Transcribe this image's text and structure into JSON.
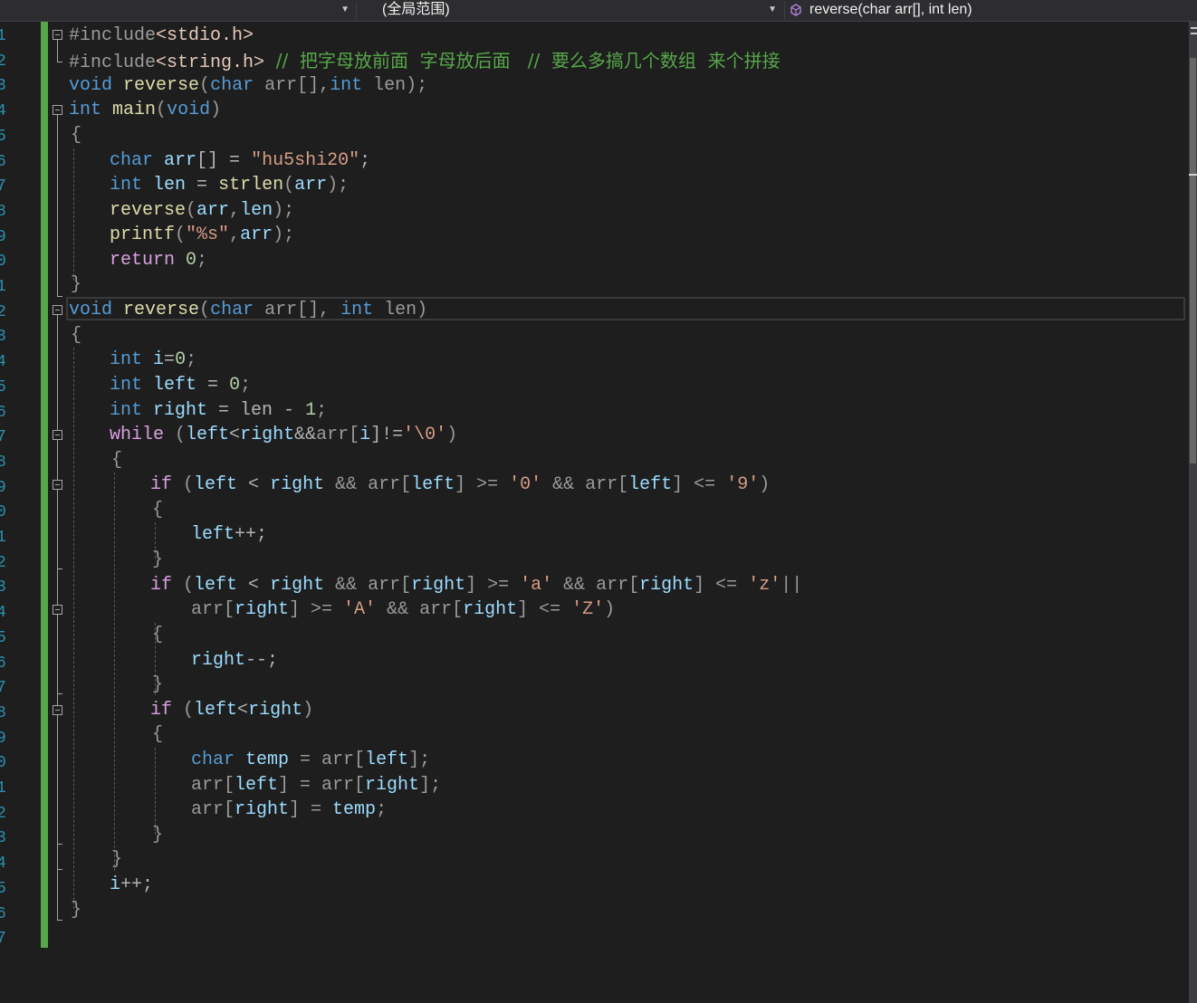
{
  "navbar": {
    "project": "",
    "scope": "(全局范围)",
    "member": "reverse(char arr[], int len)",
    "member_icon": "method-icon",
    "arrow_icon": "chevron-down-icon"
  },
  "line_numbers": [
    "1",
    "2",
    "3",
    "4",
    "5",
    "6",
    "7",
    "8",
    "9",
    "0",
    "1",
    "2",
    "3",
    "4",
    "5",
    "6",
    "7",
    "8",
    "9",
    "0",
    "1",
    "2",
    "3",
    "4",
    "5",
    "6",
    "7",
    "8",
    "9",
    "0",
    "1",
    "2",
    "3",
    "4",
    "5",
    "6",
    "7"
  ],
  "code": {
    "l1": {
      "pp": "#include",
      "inc": "<stdio.h>"
    },
    "l2": {
      "pp": "#include",
      "inc": "<string.h>",
      "comment": "  //  把字母放前面  字母放后面   //  要么多搞几个数组  来个拼接"
    },
    "l3": {
      "t1": "void",
      "t2": " ",
      "t3": "reverse",
      "t4": "(",
      "t5": "char",
      "t6": " arr[],",
      "t7": "int",
      "t8": " len);"
    },
    "l4": {
      "t1": "int",
      "t2": " ",
      "t3": "main",
      "t4": "(",
      "t5": "void",
      "t6": ")"
    },
    "l5": {
      "t1": "{"
    },
    "l6": {
      "t1": "char",
      "t2": " ",
      "t3": "arr",
      "t4": "[] = ",
      "t5": "\"hu5shi20\"",
      "t6": ";"
    },
    "l7": {
      "t1": "int",
      "t2": " ",
      "t3": "len",
      "t4": " = ",
      "t5": "strlen",
      "t6": "(",
      "t7": "arr",
      "t8": ");"
    },
    "l8": {
      "t1": "reverse",
      "t2": "(",
      "t3": "arr",
      "t4": ",",
      "t5": "len",
      "t6": ");"
    },
    "l9": {
      "t1": "printf",
      "t2": "(",
      "t3": "\"%s\"",
      "t4": ",",
      "t5": "arr",
      "t6": ");"
    },
    "l10": {
      "t1": "return",
      "t2": " ",
      "t3": "0",
      "t4": ";"
    },
    "l11": {
      "t1": "}"
    },
    "l12": {
      "t1": "void",
      "t2": " ",
      "t3": "reverse",
      "t4": "(",
      "t5": "char",
      "t6": " arr[], ",
      "t7": "int",
      "t8": " len)"
    },
    "l13": {
      "t1": "{"
    },
    "l14": {
      "t1": "int",
      "t2": " ",
      "t3": "i",
      "t4": "=",
      "t5": "0",
      "t6": ";"
    },
    "l15": {
      "t1": "int",
      "t2": " ",
      "t3": "left",
      "t4": " = ",
      "t5": "0",
      "t6": ";"
    },
    "l16": {
      "t1": "int",
      "t2": " ",
      "t3": "right",
      "t4": " = len - ",
      "t5": "1",
      "t6": ";"
    },
    "l17": {
      "t1": "while",
      "t2": " (",
      "t3": "left",
      "t4": "<",
      "t5": "right",
      "t6": "&&",
      "t7": "arr",
      "t8": "[",
      "t9": "i",
      "t10": "]!=",
      "t11": "'\\0'",
      "t12": ")"
    },
    "l18": {
      "t1": "{"
    },
    "l19": {
      "t1": "if",
      "t2": " (",
      "t3": "left",
      "t4": " < ",
      "t5": "right",
      "t6": " && arr[",
      "t7": "left",
      "t8": "] >= ",
      "t9": "'0'",
      "t10": " && arr[",
      "t11": "left",
      "t12": "] <= ",
      "t13": "'9'",
      "t14": ")"
    },
    "l20": {
      "t1": "{"
    },
    "l21": {
      "t1": "left",
      "t2": "++;"
    },
    "l22": {
      "t1": "}"
    },
    "l23": {
      "t1": "if",
      "t2": " (",
      "t3": "left",
      "t4": " < ",
      "t5": "right",
      "t6": " && arr[",
      "t7": "right",
      "t8": "] >= ",
      "t9": "'a'",
      "t10": " && arr[",
      "t11": "right",
      "t12": "] <= ",
      "t13": "'z'",
      "t14": "||"
    },
    "l24": {
      "t1": "arr[",
      "t2": "right",
      "t3": "] >= ",
      "t4": "'A'",
      "t5": " && arr[",
      "t6": "right",
      "t7": "] <= ",
      "t8": "'Z'",
      "t9": ")"
    },
    "l25": {
      "t1": "{"
    },
    "l26": {
      "t1": "right",
      "t2": "--;"
    },
    "l27": {
      "t1": "}"
    },
    "l28": {
      "t1": "if",
      "t2": " (",
      "t3": "left",
      "t4": "<",
      "t5": "right",
      "t6": ")"
    },
    "l29": {
      "t1": "{"
    },
    "l30": {
      "t1": "char",
      "t2": " ",
      "t3": "temp",
      "t4": " = arr[",
      "t5": "left",
      "t6": "];"
    },
    "l31": {
      "t1": "arr[",
      "t2": "left",
      "t3": "] = arr[",
      "t4": "right",
      "t5": "];"
    },
    "l32": {
      "t1": "arr[",
      "t2": "right",
      "t3": "] = ",
      "t4": "temp",
      "t5": ";"
    },
    "l33": {
      "t1": "}"
    },
    "l34": {
      "t1": "}"
    },
    "l35": {
      "t1": "i",
      "t2": "++;"
    },
    "l36": {
      "t1": "}"
    }
  }
}
